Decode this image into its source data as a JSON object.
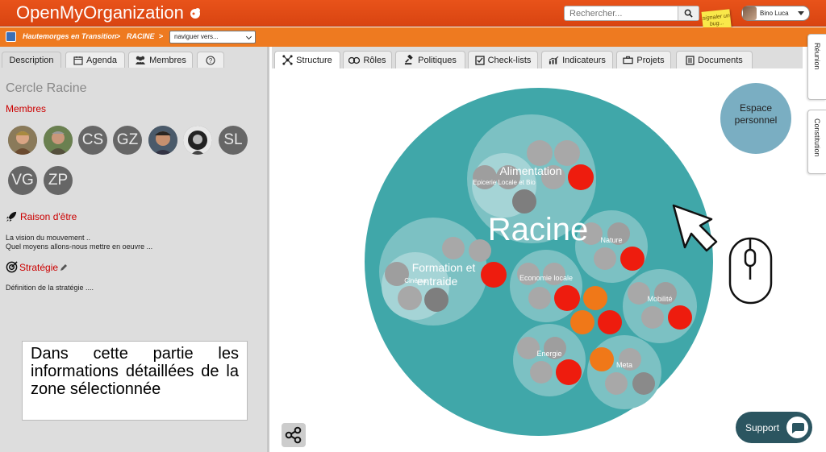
{
  "app": {
    "title": "OpenMyOrganization"
  },
  "search": {
    "placeholder": "Rechercher..."
  },
  "bug_note": {
    "text": "signaler un bug..."
  },
  "user": {
    "name": "Bino Luca"
  },
  "breadcrumb": {
    "items": [
      "Hautemorges en Transition",
      "RACINE"
    ],
    "separator": ">",
    "nav_select": "naviguer vers..."
  },
  "left_tabs": [
    {
      "label": "Description",
      "icon": ""
    },
    {
      "label": "Agenda",
      "icon": "calendar-icon"
    },
    {
      "label": "Membres",
      "icon": "users-icon"
    },
    {
      "label": "",
      "icon": "help-icon"
    }
  ],
  "circle": {
    "title": "Cercle Racine",
    "members_title": "Membres",
    "members": [
      {
        "initials": "",
        "photo": true
      },
      {
        "initials": "",
        "photo": true
      },
      {
        "initials": "CS",
        "photo": false
      },
      {
        "initials": "GZ",
        "photo": false
      },
      {
        "initials": "",
        "photo": true
      },
      {
        "initials": "",
        "photo": true
      },
      {
        "initials": "SL",
        "photo": false
      },
      {
        "initials": "VG",
        "photo": false
      },
      {
        "initials": "ZP",
        "photo": false
      }
    ],
    "purpose_title": "Raison d'être",
    "purpose_line1": "La vision du mouvement ..",
    "purpose_line2": "Quel moyens allons-nous mettre en oeuvre ...",
    "strategy_title": "Stratégie",
    "strategy_text": "Définition de la stratégie ....",
    "annotation": "Dans cette partie les informations détaillées de la zone sélectionnée"
  },
  "main_tabs": [
    {
      "label": "Structure",
      "icon": "structure-icon"
    },
    {
      "label": "Rôles",
      "icon": "roles-icon"
    },
    {
      "label": "Politiques",
      "icon": "gavel-icon"
    },
    {
      "label": "Check-lists",
      "icon": "checklist-icon"
    },
    {
      "label": "Indicateurs",
      "icon": "chart-icon"
    },
    {
      "label": "Projets",
      "icon": "briefcase-icon"
    },
    {
      "label": "Documents",
      "icon": "document-icon"
    }
  ],
  "structure": {
    "root_label": "Racine",
    "personal_space": "Espace personnel",
    "circles": {
      "alimentation": "Alimentation",
      "epicerie": "Epicerie Locale et Bio",
      "formation": "Formation et entraide",
      "cinema": "Cinéma",
      "nature": "Nature",
      "economie": "Economie locale",
      "mobilite": "Mobilité",
      "energie": "Energie",
      "meta": "Meta"
    }
  },
  "side_tabs": [
    "Réunion",
    "Constitution"
  ],
  "support": {
    "label": "Support"
  },
  "colors": {
    "header_orange": "#e8531a",
    "crumb_orange": "#ee7a20",
    "root_teal": "#40a7a9",
    "role_red": "#ee1c0e",
    "role_orange": "#f07818",
    "personal_blue": "#7aaec2"
  }
}
